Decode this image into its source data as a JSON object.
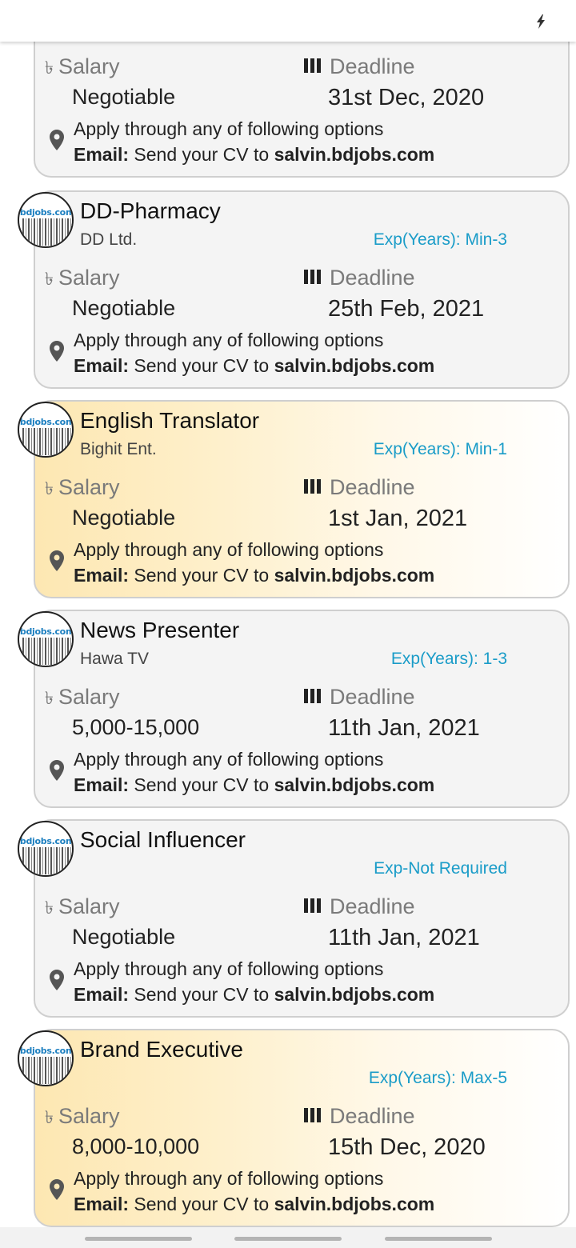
{
  "status_bar": {
    "icon": "bolt-icon"
  },
  "labels": {
    "salary": "Salary",
    "deadline": "Deadline",
    "apply": "Apply through any of following options",
    "email_prefix": "Email:",
    "email_text": "Send your CV to",
    "email_link": "salvin.bdjobs.com",
    "logo_text": "bdjobs.com",
    "currency_symbol": "৳"
  },
  "jobs": [
    {
      "title": "",
      "company": "",
      "exp": "",
      "salary": "Negotiable",
      "deadline": "31st Dec, 2020",
      "featured": false
    },
    {
      "title": "DD-Pharmacy",
      "company": "DD Ltd.",
      "exp": "Exp(Years): Min-3",
      "salary": "Negotiable",
      "deadline": "25th Feb, 2021",
      "featured": false
    },
    {
      "title": "English Translator",
      "company": "Bighit Ent.",
      "exp": "Exp(Years): Min-1",
      "salary": "Negotiable",
      "deadline": "1st Jan, 2021",
      "featured": true
    },
    {
      "title": "News Presenter",
      "company": "Hawa TV",
      "exp": "Exp(Years): 1-3",
      "salary": "5,000-15,000",
      "deadline": "11th Jan, 2021",
      "featured": false
    },
    {
      "title": "Social Influencer",
      "company": "",
      "exp": "Exp-Not Required",
      "salary": "Negotiable",
      "deadline": "11th Jan, 2021",
      "featured": false
    },
    {
      "title": "Brand Executive",
      "company": "",
      "exp": "Exp(Years): Max-5",
      "salary": "8,000-10,000",
      "deadline": "15th Dec, 2020",
      "featured": true
    }
  ],
  "colors": {
    "exp": "#1a9cc8",
    "card_bg": "#f4f4f4",
    "featured_gradient_start": "#fde7b2",
    "border": "#cfcfcf"
  }
}
